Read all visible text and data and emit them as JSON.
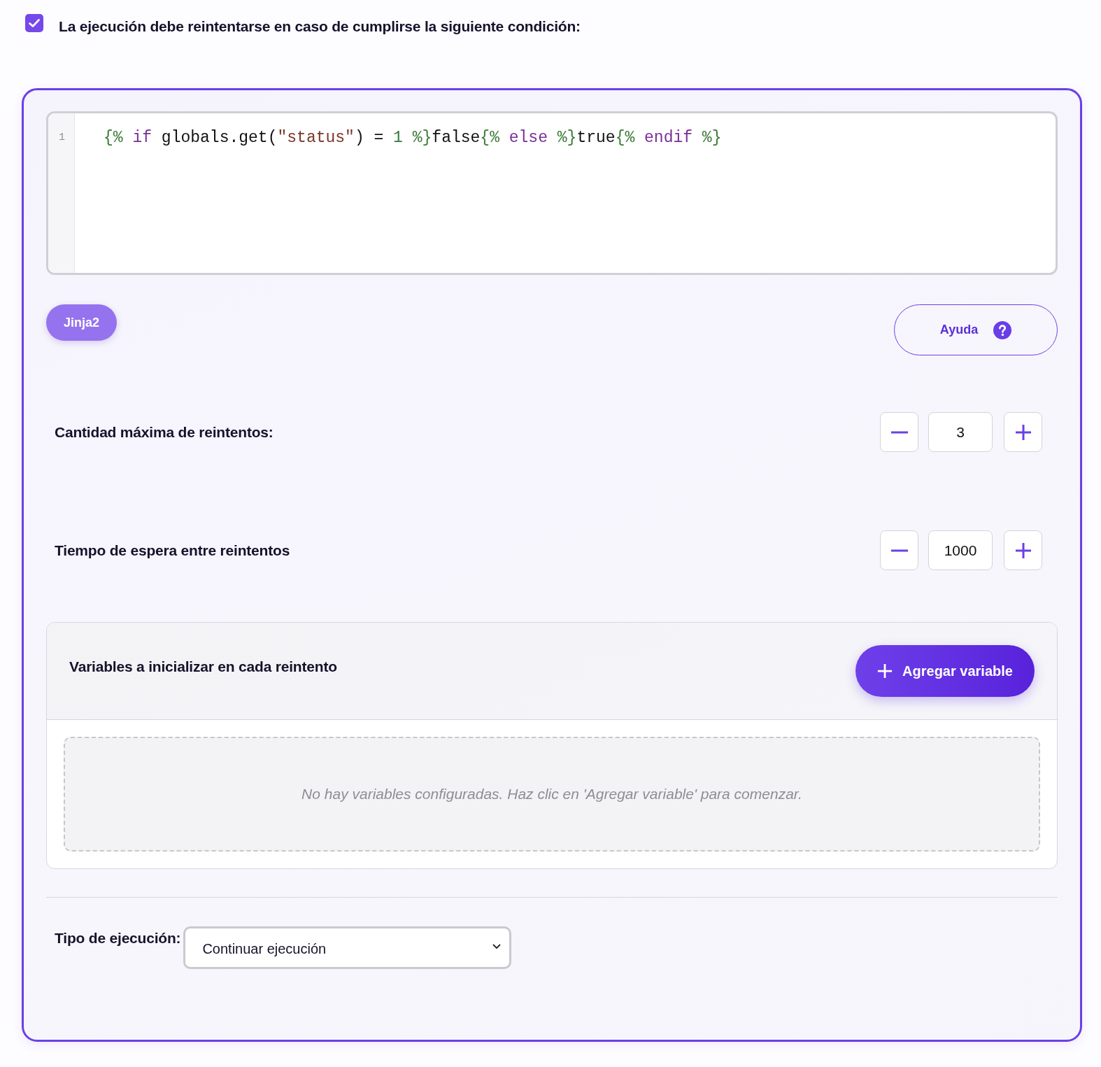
{
  "retry_condition": {
    "checked": true,
    "label": "La ejecución debe reintentarse en caso de cumplirse la siguiente condición:"
  },
  "editor": {
    "lines": [
      {
        "number": "1",
        "tokens": [
          {
            "text": "{% ",
            "kind": "delimiter"
          },
          {
            "text": "if",
            "kind": "keyword"
          },
          {
            "text": " globals.get(",
            "kind": "plain"
          },
          {
            "text": "\"status\"",
            "kind": "string"
          },
          {
            "text": ") = ",
            "kind": "plain"
          },
          {
            "text": "1 ",
            "kind": "number"
          },
          {
            "text": "%}",
            "kind": "delimiter"
          },
          {
            "text": "false",
            "kind": "plain"
          },
          {
            "text": "{% ",
            "kind": "delimiter"
          },
          {
            "text": "else",
            "kind": "keyword"
          },
          {
            "text": " %}",
            "kind": "delimiter"
          },
          {
            "text": "true",
            "kind": "plain"
          },
          {
            "text": "{% ",
            "kind": "delimiter"
          },
          {
            "text": "endif",
            "kind": "keyword"
          },
          {
            "text": " %}",
            "kind": "delimiter"
          }
        ]
      }
    ]
  },
  "language_badge": "Jinja2",
  "help_button": "Ayuda",
  "steppers": [
    {
      "label": "Cantidad máxima de reintentos:",
      "value": "3"
    },
    {
      "label": "Tiempo de espera entre reintentos",
      "value": "1000"
    }
  ],
  "variables": {
    "title": "Variables a inicializar en cada reintento",
    "add_button": "Agregar variable",
    "empty_message": "No hay variables configuradas. Haz clic en 'Agregar variable' para comenzar."
  },
  "execution_type": {
    "label": "Tipo de ejecución:",
    "value": "Continuar ejecución"
  }
}
